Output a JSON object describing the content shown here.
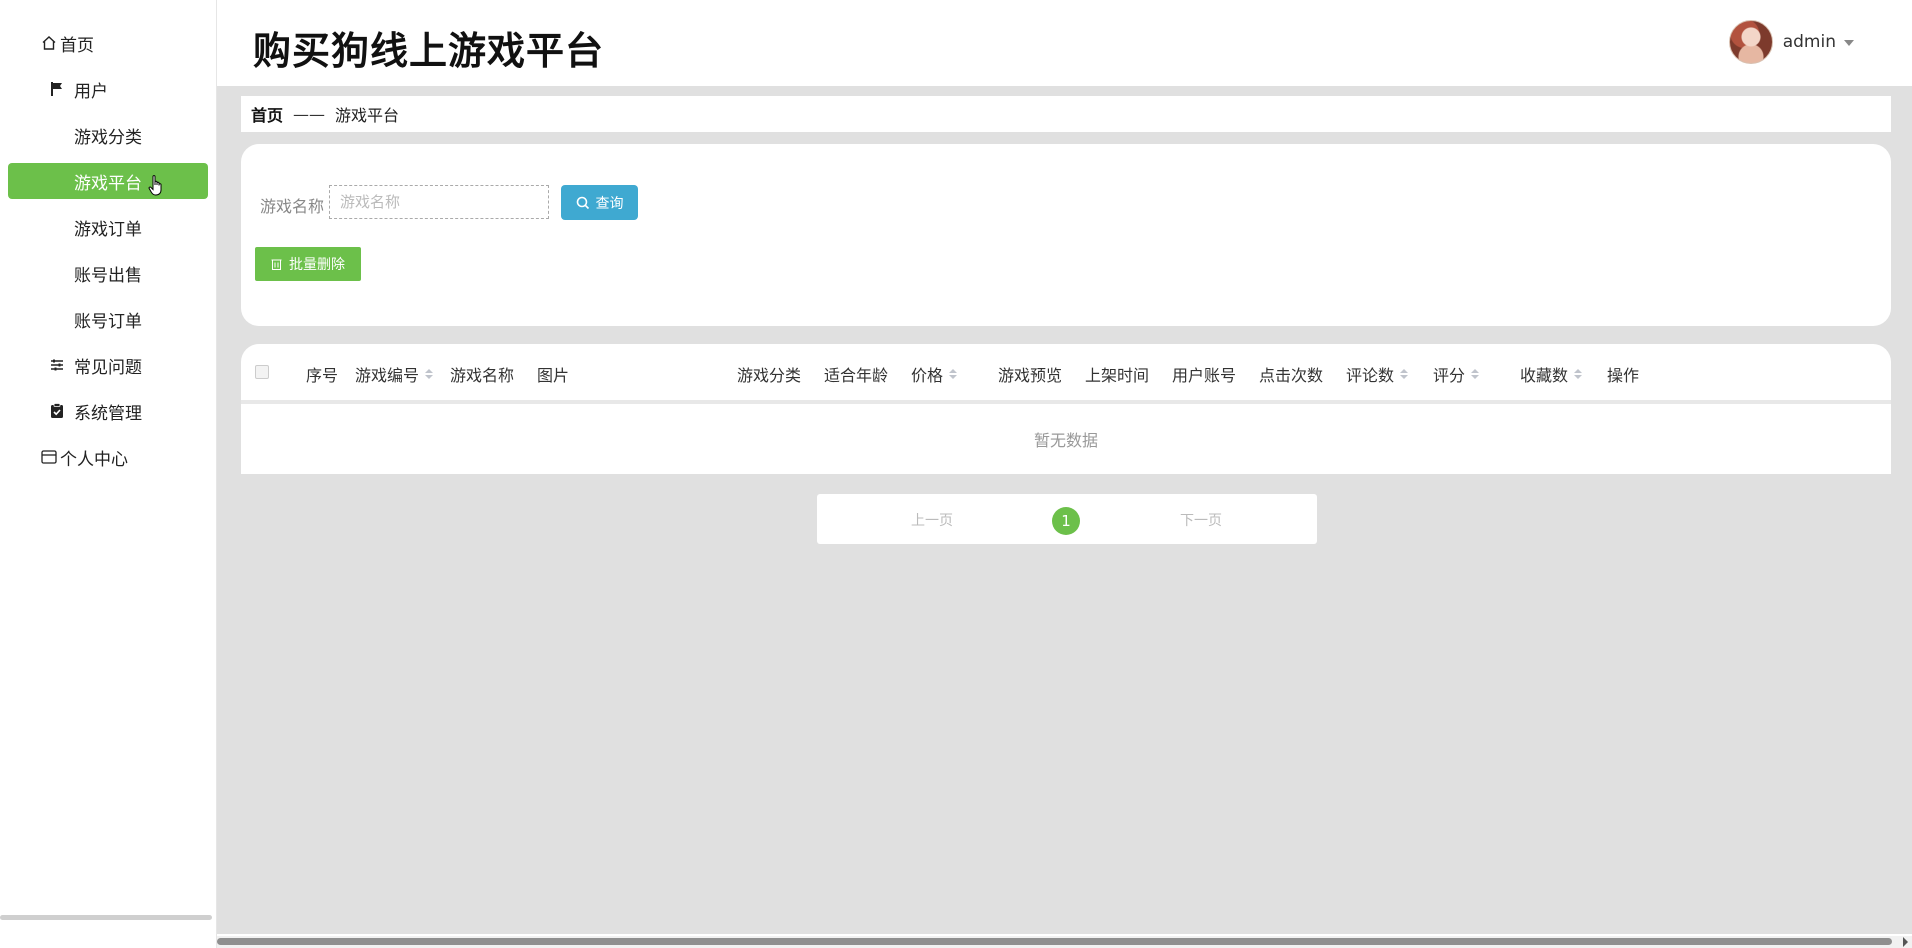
{
  "sidebar": {
    "items": [
      {
        "label": "首页",
        "icon": "home-icon"
      },
      {
        "label": "用户",
        "icon": "flag-icon"
      },
      {
        "label": "游戏分类",
        "icon": "grid-icon"
      },
      {
        "label": "游戏平台",
        "icon": "grid-icon",
        "active": true
      },
      {
        "label": "游戏订单",
        "icon": "grid-icon"
      },
      {
        "label": "账号出售",
        "icon": "grid-icon"
      },
      {
        "label": "账号订单",
        "icon": "grid-icon"
      },
      {
        "label": "常见问题",
        "icon": "sliders-icon"
      },
      {
        "label": "系统管理",
        "icon": "clipboard-check-icon"
      },
      {
        "label": "个人中心",
        "icon": "card-icon"
      }
    ]
  },
  "header": {
    "title": "购买狗线上游戏平台",
    "username": "admin"
  },
  "breadcrumb": {
    "home": "首页",
    "separator": "——",
    "current": "游戏平台"
  },
  "search": {
    "label": "游戏名称",
    "placeholder": "游戏名称",
    "value": "",
    "query_button": "查询",
    "batch_delete_button": "批量删除"
  },
  "table": {
    "columns": [
      {
        "label": "序号",
        "sortable": false
      },
      {
        "label": "游戏编号",
        "sortable": true
      },
      {
        "label": "游戏名称",
        "sortable": false
      },
      {
        "label": "图片",
        "sortable": false
      },
      {
        "label": "游戏分类",
        "sortable": false
      },
      {
        "label": "适合年龄",
        "sortable": false
      },
      {
        "label": "价格",
        "sortable": true
      },
      {
        "label": "游戏预览",
        "sortable": false
      },
      {
        "label": "上架时间",
        "sortable": false
      },
      {
        "label": "用户账号",
        "sortable": false
      },
      {
        "label": "点击次数",
        "sortable": false
      },
      {
        "label": "评论数",
        "sortable": true
      },
      {
        "label": "评分",
        "sortable": true
      },
      {
        "label": "收藏数",
        "sortable": true
      },
      {
        "label": "操作",
        "sortable": false
      }
    ],
    "empty_text": "暂无数据"
  },
  "pagination": {
    "prev": "上一页",
    "current_page": "1",
    "next": "下一页"
  },
  "colors": {
    "accent_green": "#6cc04a",
    "query_blue": "#3fa9d1",
    "background_gray": "#e0e0e0"
  }
}
